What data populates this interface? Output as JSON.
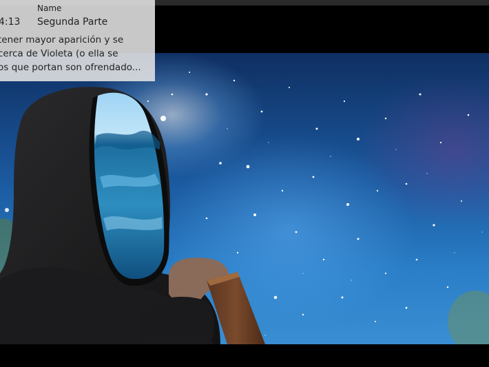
{
  "info": {
    "column_header": "Name",
    "time": "4:13",
    "name": "Segunda Parte",
    "description_lines": [
      "tener mayor aparición y se",
      "cerca de Violeta (o ella se",
      "os que portan son ofrendado..."
    ]
  },
  "image": {
    "subject": "hooded figure with ocean-wave face under starry night sky"
  }
}
